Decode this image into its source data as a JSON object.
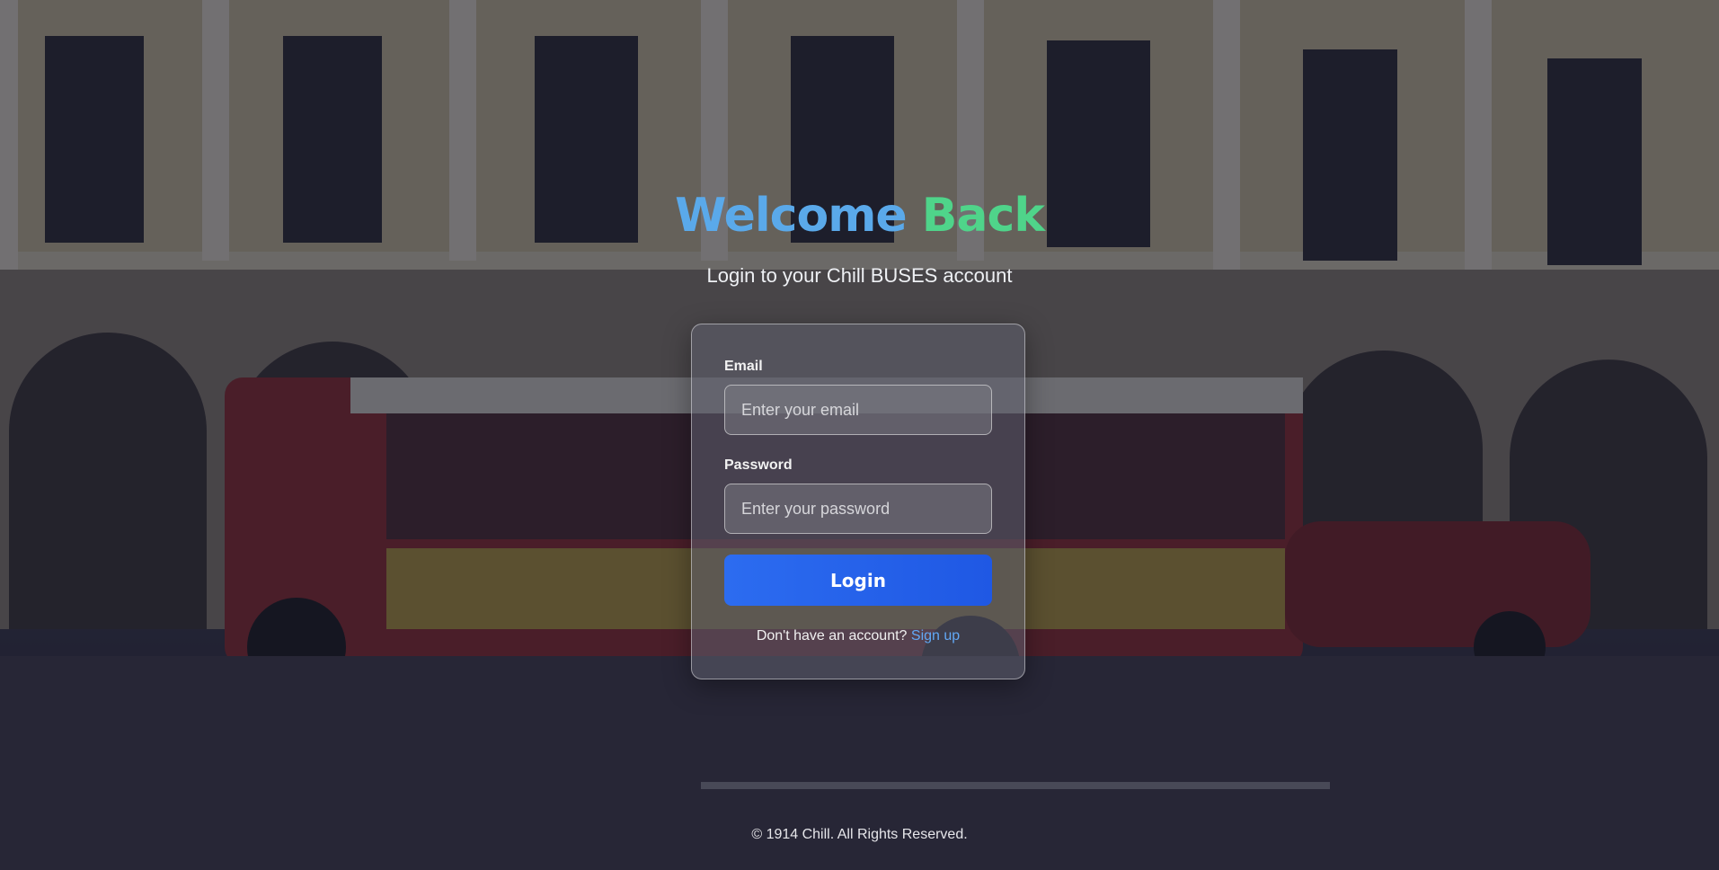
{
  "page": {
    "title_part1": "Welcome",
    "title_part2": "Back",
    "subtitle": "Login to your Chill BUSES account"
  },
  "form": {
    "email_label": "Email",
    "email_placeholder": "Enter your email",
    "email_value": "",
    "password_label": "Password",
    "password_placeholder": "Enter your password",
    "password_value": "",
    "login_label": "Login",
    "signup_prompt": "Don't have an account?",
    "signup_link": "Sign up"
  },
  "footer": {
    "copyright": "© 1914 Chill. All Rights Reserved."
  },
  "colors": {
    "title_blue": "#5aa9ea",
    "title_green": "#4fd48a",
    "button": "#2563eb",
    "link": "#62a8f5"
  }
}
